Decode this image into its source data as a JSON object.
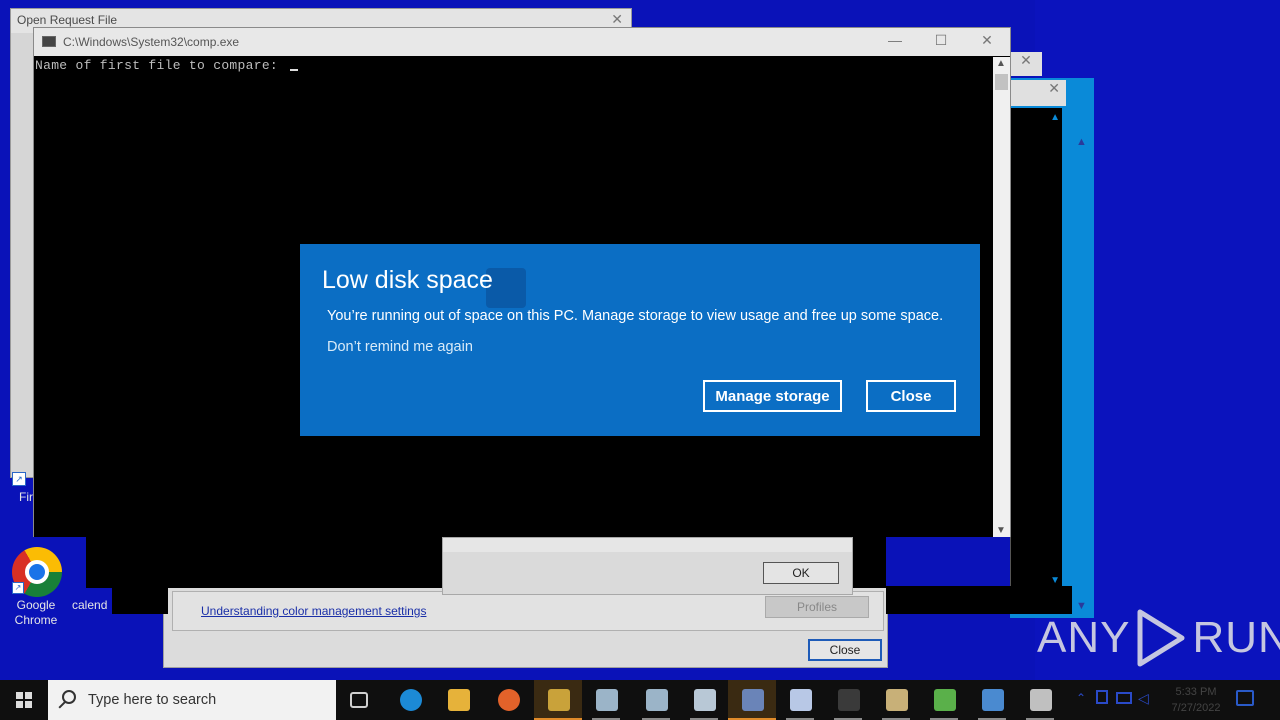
{
  "windows": {
    "open_request": {
      "title": "Open Request File",
      "close": "✕"
    },
    "console": {
      "title": "C:\\Windows\\System32\\comp.exe",
      "prompt": "Name of first file to compare: ",
      "minimize": "—",
      "maximize": "☐",
      "close": "✕",
      "scroll_up": "▲",
      "scroll_down": "▼"
    },
    "color_management": {
      "link": "Understanding color management settings",
      "profiles_button": "Profiles",
      "close_button": "Close"
    },
    "ok_dialog": {
      "ok_button": "OK"
    },
    "side_close_1": "✕",
    "side_close_2": "✕"
  },
  "toast": {
    "title": "Low disk space",
    "message": "You’re running out of space on this PC. Manage storage to view usage and free up some space.",
    "remind": "Don’t remind me again",
    "manage_button": "Manage storage",
    "close_button": "Close",
    "accent": "#0b6ec4"
  },
  "desktop_icons": [
    {
      "label": "Fir"
    },
    {
      "label": "Google Chrome"
    },
    {
      "label": "calend"
    }
  ],
  "watermark": {
    "left": "ANY",
    "right": "RUN"
  },
  "taskbar": {
    "search_placeholder": "Type here to search",
    "items": [
      {
        "name": "task-view-icon",
        "color": "#cfcfcf"
      },
      {
        "name": "edge-icon",
        "color": "#1c8ad6"
      },
      {
        "name": "file-explorer-icon",
        "color": "#e6b23a"
      },
      {
        "name": "firefox-icon",
        "color": "#e2622a"
      },
      {
        "name": "key-tool-icon",
        "color": "#c9a23a"
      },
      {
        "name": "window-app-icon",
        "color": "#9bb4c8"
      },
      {
        "name": "window-app-icon-2",
        "color": "#9bb4c8"
      },
      {
        "name": "cube-app-icon",
        "color": "#b8c8d6"
      },
      {
        "name": "active-app-icon",
        "color": "#6a84b8"
      },
      {
        "name": "window-app-icon-3",
        "color": "#b8c8e6"
      },
      {
        "name": "terminal-icon",
        "color": "#3a3a3a"
      },
      {
        "name": "printer-icon",
        "color": "#c8b078"
      },
      {
        "name": "network-tool-icon",
        "color": "#5ab04a"
      },
      {
        "name": "monitor-icon",
        "color": "#4a8ad0"
      },
      {
        "name": "window-app-icon-4",
        "color": "#c0c0c0"
      }
    ],
    "clock_time": "5:33 PM",
    "clock_date": "7/27/2022"
  }
}
